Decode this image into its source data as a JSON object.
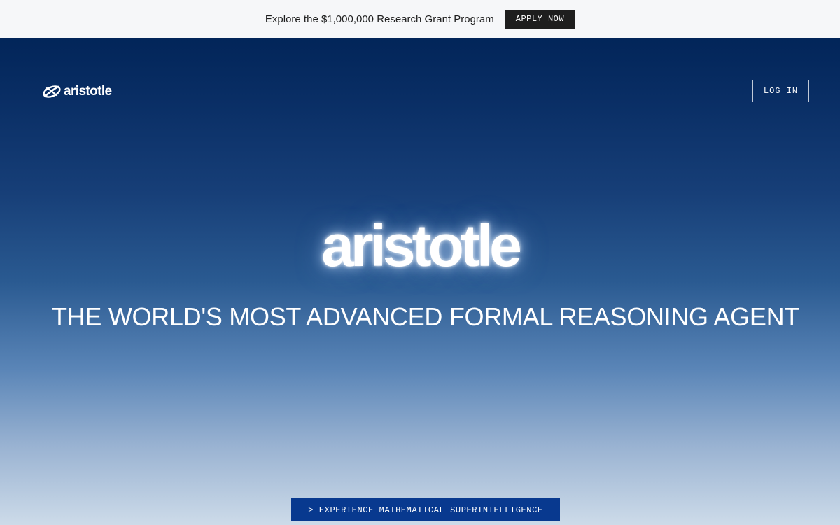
{
  "announcement": {
    "text": "Explore the $1,000,000 Research Grant Program",
    "button_label": "APPLY NOW"
  },
  "header": {
    "brand_name": "aristotle",
    "brand_icon": "aristotle-logo-icon",
    "login_label": "LOG IN"
  },
  "hero": {
    "wordmark": "aristotle",
    "tagline": "THE WORLD'S MOST ADVANCED FORMAL REASONING AGENT",
    "cta_label": "> EXPERIENCE MATHEMATICAL SUPERINTELLIGENCE"
  },
  "colors": {
    "announcement_bg": "#f6f7f9",
    "apply_button_bg": "#1e1e1e",
    "hero_top": "#022559",
    "hero_bottom": "#cddbe9",
    "cta_bg": "#08398f"
  }
}
